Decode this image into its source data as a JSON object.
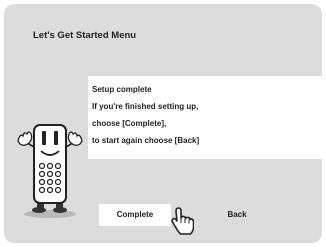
{
  "menu": {
    "title": "Let's Get Started Menu"
  },
  "message": {
    "lines": [
      "Setup complete",
      "If you're finished setting up,",
      "choose [Complete],",
      "to start again choose [Back]"
    ]
  },
  "buttons": {
    "complete_label": "Complete",
    "back_label": "Back"
  },
  "icons": {
    "mascot": "remote-control-mascot-icon",
    "cursor": "pointing-hand-cursor-icon"
  },
  "colors": {
    "screen_bg": "#dcdcdc",
    "panel_bg": "#ffffff",
    "text": "#222222"
  }
}
